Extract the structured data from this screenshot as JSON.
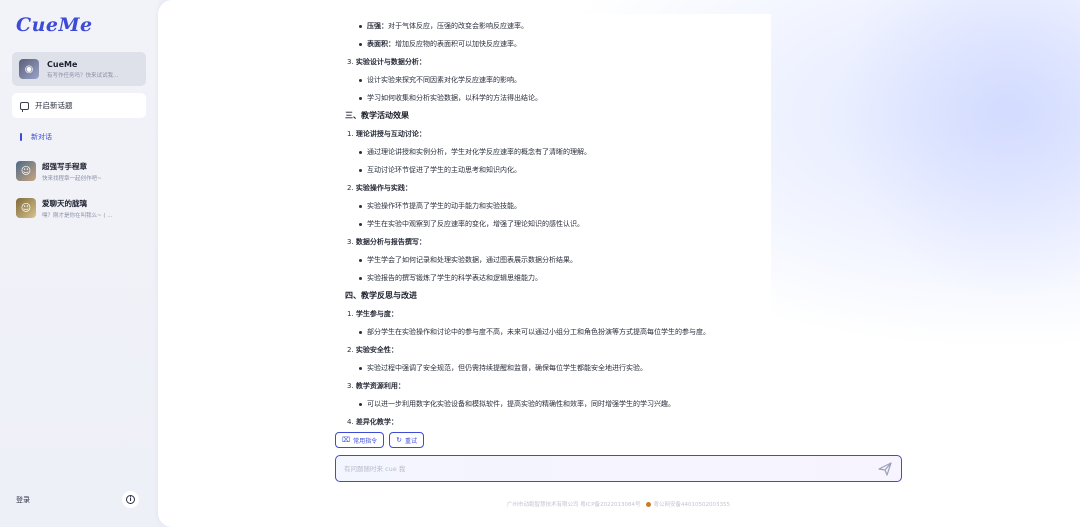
{
  "app": {
    "logo": "CueMe"
  },
  "sidebar": {
    "agent": {
      "name": "CueMe",
      "subtitle": "有写作任务吗？快来试试我..."
    },
    "new_topic": "开启新话题",
    "section": "新对话",
    "chats": [
      {
        "title": "超强写手程章",
        "subtitle": "快来找程章一起创作吧~"
      },
      {
        "title": "爱聊天的胧璃",
        "subtitle": "嘿？刚才是你在叫我么~ ( ..."
      }
    ],
    "login": "登录",
    "info_icon": "info-circle-icon"
  },
  "content": {
    "lines": [
      {
        "kind": "bul",
        "bold": "压强：",
        "text": "对于气体反应，压强的改变会影响反应速率。"
      },
      {
        "kind": "bul",
        "bold": "表面积：",
        "text": "增加反应物的表面积可以加快反应速率。"
      },
      {
        "kind": "num",
        "prefix": "3. ",
        "bold": "实验设计与数据分析：",
        "text": ""
      },
      {
        "kind": "bul",
        "bold": "",
        "text": "设计实验来探究不同因素对化学反应速率的影响。"
      },
      {
        "kind": "bul",
        "bold": "",
        "text": "学习如何收集和分析实验数据，以科学的方法得出结论。"
      },
      {
        "kind": "h2",
        "text": "三、教学活动效果"
      },
      {
        "kind": "num",
        "prefix": "1. ",
        "bold": "理论讲授与互动讨论：",
        "text": ""
      },
      {
        "kind": "bul",
        "bold": "",
        "text": "通过理论讲授和实例分析，学生对化学反应速率的概念有了清晰的理解。"
      },
      {
        "kind": "bul",
        "bold": "",
        "text": "互动讨论环节促进了学生的主动思考和知识内化。"
      },
      {
        "kind": "num",
        "prefix": "2. ",
        "bold": "实验操作与实践：",
        "text": ""
      },
      {
        "kind": "bul",
        "bold": "",
        "text": "实验操作环节提高了学生的动手能力和实验技能。"
      },
      {
        "kind": "bul",
        "bold": "",
        "text": "学生在实验中观察到了反应速率的变化，增强了理论知识的感性认识。"
      },
      {
        "kind": "num",
        "prefix": "3. ",
        "bold": "数据分析与报告撰写：",
        "text": ""
      },
      {
        "kind": "bul",
        "bold": "",
        "text": "学生学会了如何记录和处理实验数据，通过图表展示数据分析结果。"
      },
      {
        "kind": "bul",
        "bold": "",
        "text": "实验报告的撰写锻炼了学生的科学表达和逻辑思维能力。"
      },
      {
        "kind": "h2",
        "text": "四、教学反思与改进"
      },
      {
        "kind": "num",
        "prefix": "1. ",
        "bold": "学生参与度：",
        "text": ""
      },
      {
        "kind": "bul",
        "bold": "",
        "text": "部分学生在实验操作和讨论中的参与度不高，未来可以通过小组分工和角色扮演等方式提高每位学生的参与度。"
      },
      {
        "kind": "num",
        "prefix": "2. ",
        "bold": "实验安全性：",
        "text": ""
      },
      {
        "kind": "bul",
        "bold": "",
        "text": "实验过程中强调了安全规范，但仍需持续提醒和监督，确保每位学生都能安全地进行实验。"
      },
      {
        "kind": "num",
        "prefix": "3. ",
        "bold": "教学资源利用：",
        "text": ""
      },
      {
        "kind": "bul",
        "bold": "",
        "text": "可以进一步利用数字化实验设备和模拟软件，提高实验的精确性和效率，同时增强学生的学习兴趣。"
      },
      {
        "kind": "num",
        "prefix": "4. ",
        "bold": "差异化教学：",
        "text": ""
      }
    ]
  },
  "actions": {
    "common": "常用指令",
    "retry": "重试"
  },
  "input": {
    "placeholder": "有问题随时来 cue 我",
    "value": ""
  },
  "footer": {
    "company": "广州市动跑智慧技术有限公司 粤ICP备2022013084号",
    "police": "粤公网安备44010502003355"
  },
  "colors": {
    "accent": "#3d4bd6"
  }
}
